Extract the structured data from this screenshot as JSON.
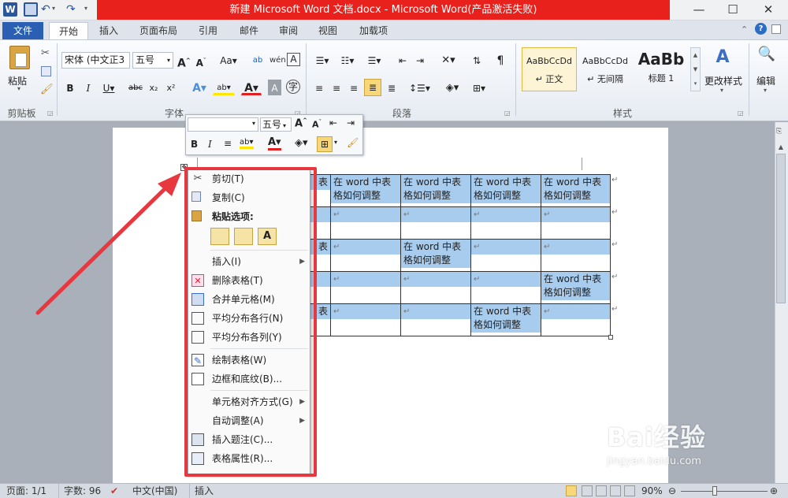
{
  "window": {
    "title": "新建 Microsoft Word 文档.docx - Microsoft Word(产品激活失败)",
    "minimize": "—",
    "maximize": "☐",
    "close": "✕"
  },
  "tabs": {
    "file": "文件",
    "items": [
      "开始",
      "插入",
      "页面布局",
      "引用",
      "邮件",
      "审阅",
      "视图",
      "加载项"
    ]
  },
  "ribbon": {
    "clipboard": {
      "paste": "粘贴",
      "group": "剪贴板"
    },
    "font": {
      "name": "宋体 (中文正3",
      "size": "五号",
      "group": "字体"
    },
    "paragraph": {
      "group": "段落"
    },
    "styles": {
      "group": "样式",
      "cards": [
        {
          "preview": "AaBbCcDd",
          "name": "↵ 正文"
        },
        {
          "preview": "AaBbCcDd",
          "name": "↵ 无间隔"
        },
        {
          "preview": "AaBb",
          "name": "标题 1"
        }
      ],
      "change": "更改样式"
    },
    "editing": {
      "label": "编辑"
    }
  },
  "mini_toolbar": {
    "size": "五号"
  },
  "table": {
    "cell_text": "在 word 中表格如何调整",
    "partial": "表",
    "return_mark": "↵"
  },
  "context_menu": {
    "items": [
      {
        "label": "剪切(T)",
        "icon": "scissors-icon",
        "sub": false
      },
      {
        "label": "复制(C)",
        "icon": "copy-icon",
        "sub": false
      },
      {
        "label": "粘贴选项:",
        "icon": "paste-icon",
        "sub": false,
        "bold": true
      },
      {
        "label": "插入(I)",
        "icon": "",
        "sub": true
      },
      {
        "label": "删除表格(T)",
        "icon": "delete-table-icon",
        "sub": false
      },
      {
        "label": "合并单元格(M)",
        "icon": "merge-cells-icon",
        "sub": false
      },
      {
        "label": "平均分布各行(N)",
        "icon": "distribute-rows-icon",
        "sub": false
      },
      {
        "label": "平均分布各列(Y)",
        "icon": "distribute-columns-icon",
        "sub": false
      },
      {
        "label": "绘制表格(W)",
        "icon": "draw-table-icon",
        "sub": false
      },
      {
        "label": "边框和底纹(B)...",
        "icon": "borders-icon",
        "sub": false
      },
      {
        "label": "单元格对齐方式(G)",
        "icon": "",
        "sub": true
      },
      {
        "label": "自动调整(A)",
        "icon": "",
        "sub": true
      },
      {
        "label": "插入题注(C)...",
        "icon": "caption-icon",
        "sub": false
      },
      {
        "label": "表格属性(R)...",
        "icon": "table-properties-icon",
        "sub": false
      }
    ]
  },
  "status": {
    "page": "页面: 1/1",
    "words": "字数: 96",
    "language": "中文(中国)",
    "mode": "插入",
    "zoom": "90%"
  },
  "watermark": {
    "brand": "Bai经验",
    "url": "jingyan.baidu.com"
  }
}
